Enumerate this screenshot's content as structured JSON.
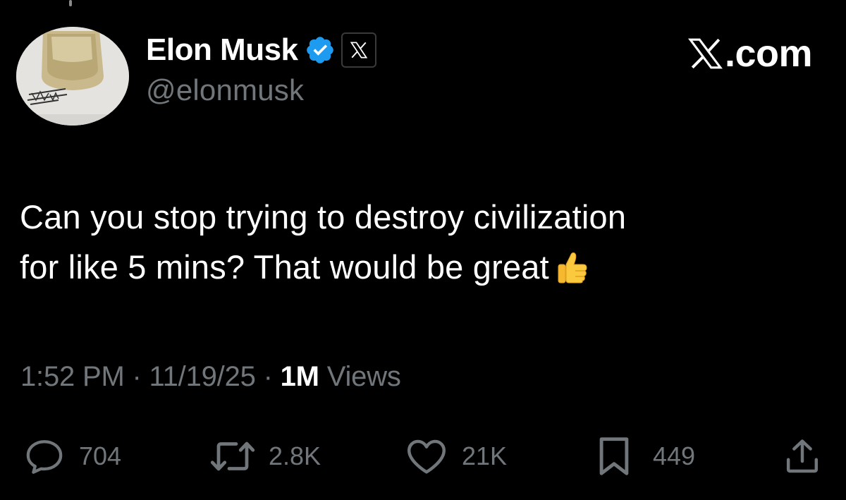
{
  "author": {
    "display_name": "Elon Musk",
    "handle": "@elonmusk",
    "verified_badge_color": "#1d9bf0"
  },
  "brand": {
    "text": ".com"
  },
  "tweet": {
    "line1": "Can you stop trying to destroy civilization",
    "line2": "for like 5 mins? That would be great"
  },
  "meta": {
    "time": "1:52 PM",
    "sep1": " · ",
    "date": "11/19/25",
    "sep2": " · ",
    "views_count": "1M",
    "views_label": " Views"
  },
  "actions": {
    "replies": "704",
    "reposts": "2.8K",
    "likes": "21K",
    "bookmarks": "449"
  },
  "icons": {
    "reply": "reply-icon",
    "repost": "repost-icon",
    "like": "heart-icon",
    "bookmark": "bookmark-icon",
    "share": "share-icon"
  },
  "colors": {
    "background": "#000000",
    "text": "#ffffff",
    "muted": "#71767b"
  }
}
